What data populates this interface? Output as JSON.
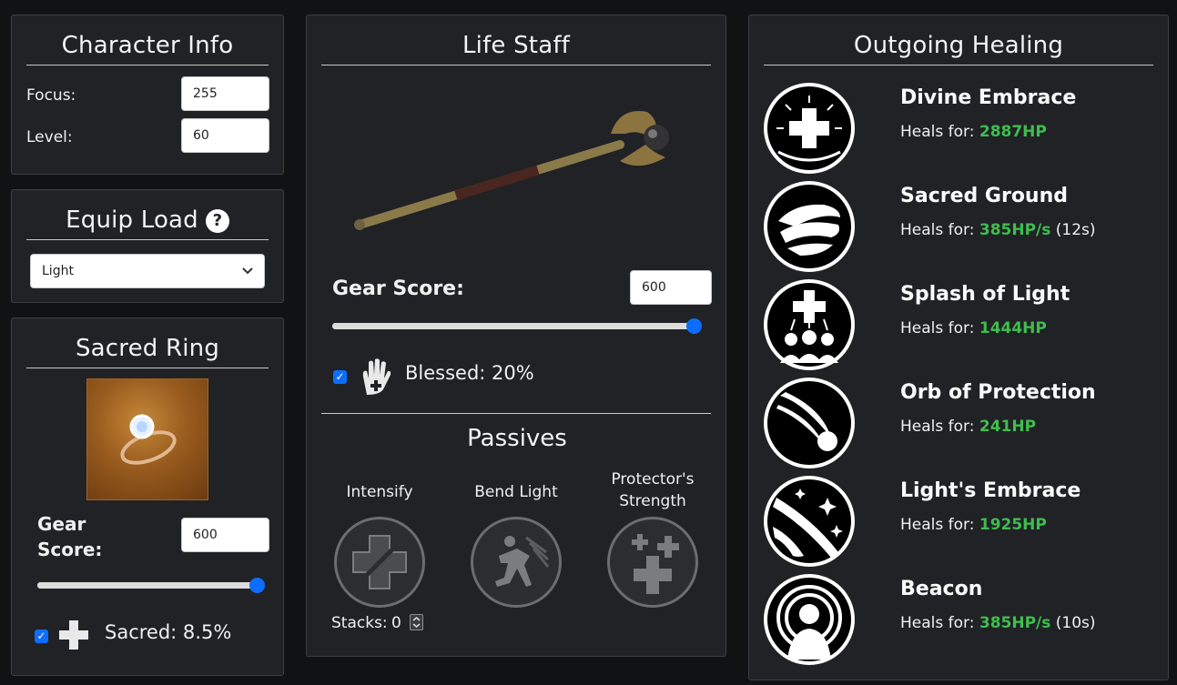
{
  "character_info": {
    "title": "Character Info",
    "focus_label": "Focus:",
    "focus_value": "255",
    "level_label": "Level:",
    "level_value": "60"
  },
  "equip_load": {
    "title": "Equip Load",
    "help_glyph": "?",
    "selected": "Light"
  },
  "sacred_ring": {
    "title": "Sacred Ring",
    "gear_score_label": "Gear Score:",
    "gear_score_value": "600",
    "slider_fraction": 1.0,
    "checkbox_checked": true,
    "perk_label": "Sacred: 8.5%"
  },
  "life_staff": {
    "title": "Life Staff",
    "gear_score_label": "Gear Score:",
    "gear_score_value": "600",
    "slider_fraction": 1.0,
    "checkbox_checked": true,
    "perk_label": "Blessed: 20%",
    "passives_title": "Passives",
    "passives": [
      {
        "name": "Intensify",
        "icon": "intensify-icon"
      },
      {
        "name": "Bend Light",
        "icon": "bend-light-icon"
      },
      {
        "name": "Protector's Strength",
        "icon": "protectors-strength-icon"
      }
    ],
    "stacks_label": "Stacks:",
    "stacks_value": "0"
  },
  "outgoing_healing": {
    "title": "Outgoing Healing",
    "heals_for_label": "Heals for:",
    "abilities": [
      {
        "name": "Divine Embrace",
        "amount": "2887HP",
        "duration": "",
        "icon": "divine-embrace-icon"
      },
      {
        "name": "Sacred Ground",
        "amount": "385HP/s",
        "duration": "(12s)",
        "icon": "sacred-ground-icon"
      },
      {
        "name": "Splash of Light",
        "amount": "1444HP",
        "duration": "",
        "icon": "splash-of-light-icon"
      },
      {
        "name": "Orb of Protection",
        "amount": "241HP",
        "duration": "",
        "icon": "orb-of-protection-icon"
      },
      {
        "name": "Light's Embrace",
        "amount": "1925HP",
        "duration": "",
        "icon": "lights-embrace-icon"
      },
      {
        "name": "Beacon",
        "amount": "385HP/s",
        "duration": "(10s)",
        "icon": "beacon-icon"
      }
    ]
  },
  "colors": {
    "accent": "#0d6efd",
    "heal_green": "#3fbd4e",
    "panel_bg": "#202226",
    "page_bg": "#111214"
  }
}
